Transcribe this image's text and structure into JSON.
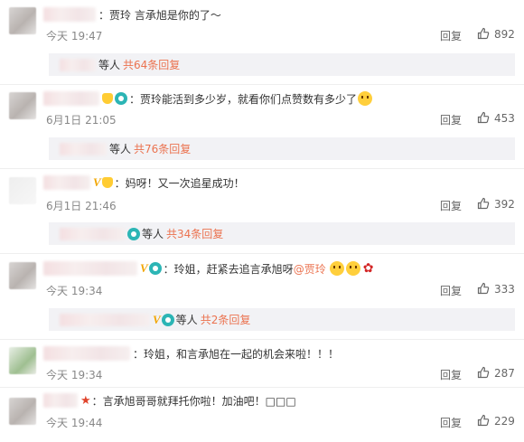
{
  "comments": [
    {
      "text": "：贾玲 言承旭是你的了～",
      "time": "今天 19:47",
      "reply": "回复",
      "likes": "892",
      "sub_users": "等人",
      "sub_count": "共64条回复"
    },
    {
      "text": "：贾玲能活到多少岁，就看你们点赞数有多少了",
      "time": "6月1日 21:05",
      "reply": "回复",
      "likes": "453",
      "sub_users": "等人",
      "sub_count": "共76条回复"
    },
    {
      "text": "：妈呀！又一次追星成功！",
      "time": "6月1日 21:46",
      "reply": "回复",
      "likes": "392",
      "sub_users": "等人",
      "sub_count": "共34条回复"
    },
    {
      "text": "：玲姐，赶紧去追言承旭呀",
      "mention": "@贾玲",
      "time": "今天 19:34",
      "reply": "回复",
      "likes": "333",
      "sub_users": "等人",
      "sub_count": "共2条回复"
    },
    {
      "text": "：玲姐，和言承旭在一起的机会来啦！！！",
      "time": "今天 19:34",
      "reply": "回复",
      "likes": "287"
    },
    {
      "text": "：言承旭哥哥就拜托你啦！加油吧！□□□",
      "time": "今天 19:44",
      "reply": "回复",
      "likes": "229"
    }
  ],
  "icons": {
    "like": "thumbs-up-icon",
    "vip": "vip-v-icon",
    "camera": "camera-badge-icon",
    "emoji": "emoji-icon",
    "rose": "rose-icon",
    "star": "star-badge-icon"
  },
  "colors": {
    "reply_accent": "#eb7350",
    "mention": "#eb7350",
    "subpanel_bg": "#f2f2f5",
    "muted_text": "#888888"
  }
}
